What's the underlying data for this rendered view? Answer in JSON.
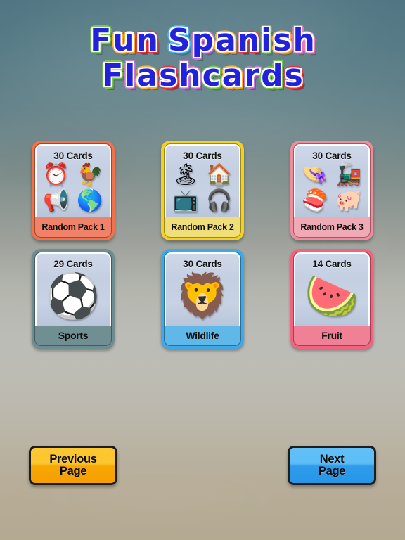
{
  "app": {
    "title_line1": "Fun Spanish",
    "title_line2": "Flashcards",
    "background_top_color": "#4d7380",
    "background_mid_color": "#bcbcb7",
    "background_bottom_color": "#b4aa92"
  },
  "decks": [
    {
      "count_label": "30 Cards",
      "name": "Random Pack 1",
      "border_color": "#f0714a",
      "label_color": "#ef8268",
      "icons": [
        "alarm-clock-icon",
        "rooster-icon",
        "whistle-icon",
        "globe-icon"
      ],
      "glyphs": [
        "⏰",
        "🐓",
        "📢",
        "🌎"
      ]
    },
    {
      "count_label": "30 Cards",
      "name": "Random Pack 2",
      "border_color": "#f3d123",
      "label_color": "#f0de7a",
      "icons": [
        "desert-island-icon",
        "house-icon",
        "oven-icon",
        "headphones-icon"
      ],
      "glyphs": [
        "🏝",
        "🏠",
        "📺",
        "🎧"
      ]
    },
    {
      "count_label": "30 Cards",
      "name": "Random Pack 3",
      "border_color": "#ef8d9d",
      "label_color": "#efaab5",
      "icons": [
        "hat-icon",
        "train-icon",
        "sushi-icon",
        "pig-icon"
      ],
      "glyphs": [
        "👒",
        "🚂",
        "🍣",
        "🐖"
      ]
    },
    {
      "count_label": "29 Cards",
      "name": "Sports",
      "border_color": "#6d8d91",
      "label_color": "#6f8f93",
      "icons": [
        "soccer-player-icon"
      ],
      "glyphs": [
        "⚽"
      ]
    },
    {
      "count_label": "30 Cards",
      "name": "Wildlife",
      "border_color": "#3fa9e8",
      "label_color": "#5fb8e8",
      "icons": [
        "lion-icon"
      ],
      "glyphs": [
        "🦁"
      ]
    },
    {
      "count_label": "14 Cards",
      "name": "Fruit",
      "border_color": "#f2637f",
      "label_color": "#ef8096",
      "icons": [
        "watermelon-icon"
      ],
      "glyphs": [
        "🍉"
      ]
    }
  ],
  "footer": {
    "previous_page_line1": "Previous",
    "previous_page_line2": "Page",
    "previous_page_color": "#fcc62f",
    "next_page_line1": "Next",
    "next_page_line2": "Page",
    "next_page_color": "#5dbdf6"
  },
  "title_letters": {
    "line1": [
      {
        "ch": "F",
        "color": "green"
      },
      {
        "ch": "u",
        "color": "orange"
      },
      {
        "ch": "n",
        "color": "red"
      },
      {
        "ch": " ",
        "color": "space"
      },
      {
        "ch": "S",
        "color": "blue"
      },
      {
        "ch": "p",
        "color": "purple"
      },
      {
        "ch": "a",
        "color": "orange"
      },
      {
        "ch": "n",
        "color": "red"
      },
      {
        "ch": "i",
        "color": "green"
      },
      {
        "ch": "s",
        "color": "orange"
      },
      {
        "ch": "h",
        "color": "pink"
      }
    ],
    "line2": [
      {
        "ch": "F",
        "color": "green"
      },
      {
        "ch": "l",
        "color": "purple"
      },
      {
        "ch": "a",
        "color": "orange"
      },
      {
        "ch": "s",
        "color": "red"
      },
      {
        "ch": "h",
        "color": "purple"
      },
      {
        "ch": "c",
        "color": "green"
      },
      {
        "ch": "a",
        "color": "orange"
      },
      {
        "ch": "r",
        "color": "purple"
      },
      {
        "ch": "d",
        "color": "green"
      },
      {
        "ch": "s",
        "color": "red"
      }
    ]
  }
}
